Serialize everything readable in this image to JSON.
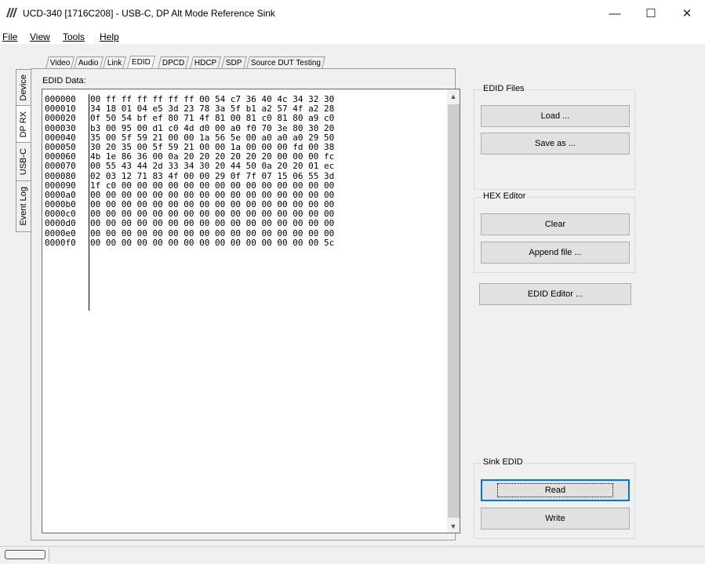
{
  "window": {
    "title": "UCD-340 [1716C208] - USB-C, DP Alt Mode Reference Sink",
    "minimize_glyph": "—",
    "maximize_glyph": "☐",
    "close_glyph": "✕"
  },
  "menu": {
    "file": "File",
    "view": "View",
    "tools": "Tools",
    "help": "Help"
  },
  "top_tabs": [
    "Video",
    "Audio",
    "Link",
    "EDID",
    "DPCD",
    "HDCP",
    "SDP",
    "Source DUT Testing"
  ],
  "active_top_tab": "EDID",
  "side_tabs": [
    "Device",
    "DP RX",
    "USB-C",
    "Event Log"
  ],
  "active_side_tab": "DP RX",
  "edid": {
    "label": "EDID Data:",
    "rows": [
      {
        "addr": "000000",
        "bytes": "00 ff ff ff ff ff ff 00 54 c7 36 40 4c 34 32 30"
      },
      {
        "addr": "000010",
        "bytes": "34 18 01 04 e5 3d 23 78 3a 5f b1 a2 57 4f a2 28"
      },
      {
        "addr": "000020",
        "bytes": "0f 50 54 bf ef 80 71 4f 81 00 81 c0 81 80 a9 c0"
      },
      {
        "addr": "000030",
        "bytes": "b3 00 95 00 d1 c0 4d d0 00 a0 f0 70 3e 80 30 20"
      },
      {
        "addr": "000040",
        "bytes": "35 00 5f 59 21 00 00 1a 56 5e 00 a0 a0 a0 29 50"
      },
      {
        "addr": "000050",
        "bytes": "30 20 35 00 5f 59 21 00 00 1a 00 00 00 fd 00 38"
      },
      {
        "addr": "000060",
        "bytes": "4b 1e 86 36 00 0a 20 20 20 20 20 20 00 00 00 fc"
      },
      {
        "addr": "000070",
        "bytes": "00 55 43 44 2d 33 34 30 20 44 50 0a 20 20 01 ec"
      },
      {
        "addr": "000080",
        "bytes": "02 03 12 71 83 4f 00 00 29 0f 7f 07 15 06 55 3d"
      },
      {
        "addr": "000090",
        "bytes": "1f c0 00 00 00 00 00 00 00 00 00 00 00 00 00 00"
      },
      {
        "addr": "0000a0",
        "bytes": "00 00 00 00 00 00 00 00 00 00 00 00 00 00 00 00"
      },
      {
        "addr": "0000b0",
        "bytes": "00 00 00 00 00 00 00 00 00 00 00 00 00 00 00 00"
      },
      {
        "addr": "0000c0",
        "bytes": "00 00 00 00 00 00 00 00 00 00 00 00 00 00 00 00"
      },
      {
        "addr": "0000d0",
        "bytes": "00 00 00 00 00 00 00 00 00 00 00 00 00 00 00 00"
      },
      {
        "addr": "0000e0",
        "bytes": "00 00 00 00 00 00 00 00 00 00 00 00 00 00 00 00"
      },
      {
        "addr": "0000f0",
        "bytes": "00 00 00 00 00 00 00 00 00 00 00 00 00 00 00 5c"
      }
    ]
  },
  "edid_files": {
    "title": "EDID Files",
    "load": "Load ...",
    "save_as": "Save as ..."
  },
  "hex_editor": {
    "title": "HEX Editor",
    "clear": "Clear",
    "append_file": "Append file ..."
  },
  "edid_editor_button": "EDID Editor ...",
  "sink_edid": {
    "title": "Sink EDID",
    "read": "Read",
    "write": "Write"
  },
  "scroll": {
    "up": "▲",
    "down": "▼"
  },
  "colors": {
    "focus_border": "#0078d7",
    "window_bg": "#f0f0f0"
  }
}
